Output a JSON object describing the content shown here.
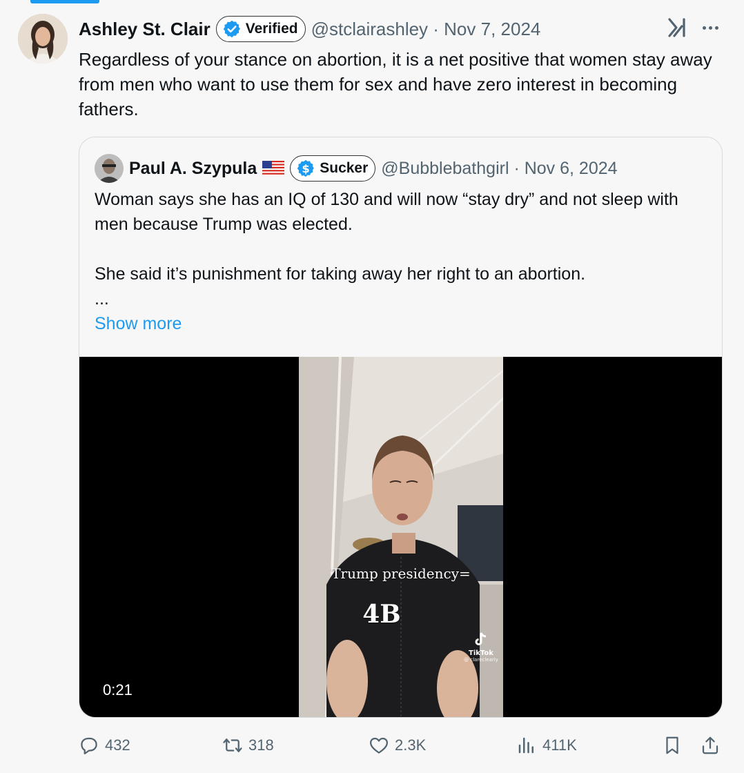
{
  "tweet": {
    "author_name": "Ashley St. Clair",
    "badge_label": "Verified",
    "handle_date": "@stclairashley · Nov 7, 2024",
    "text": "Regardless of your stance on abortion, it is a net positive that women stay away from men who want to use them for sex and have zero interest in becoming fathers."
  },
  "quoted": {
    "author_name": "Paul A. Szypula",
    "badge_label": "Sucker",
    "handle_date": "@Bubblebathgirl · Nov 6, 2024",
    "paragraph_1": "Woman says she has an IQ of 130 and will now “stay dry” and not sleep with men because Trump was elected.",
    "paragraph_2": "She said it’s punishment for taking away her right to an abortion.",
    "ellipsis": "...",
    "show_more": "Show more",
    "video": {
      "overlay_line_1": "Trump presidency=",
      "overlay_line_2": "4B",
      "watermark_name": "TikTok",
      "watermark_handle": "@ clareclearly",
      "duration": "0:21"
    }
  },
  "actions": {
    "replies": "432",
    "reposts": "318",
    "likes": "2.3K",
    "views": "411K"
  },
  "colors": {
    "accent": "#1d9bf0",
    "text": "#0f1419",
    "muted": "#536471",
    "background": "#f7f7f7"
  },
  "icons": [
    "grok-icon",
    "more-icon",
    "verified-check-icon",
    "dollar-badge-icon",
    "us-flag-icon",
    "reply-icon",
    "repost-icon",
    "like-icon",
    "views-icon",
    "bookmark-icon",
    "share-icon"
  ]
}
